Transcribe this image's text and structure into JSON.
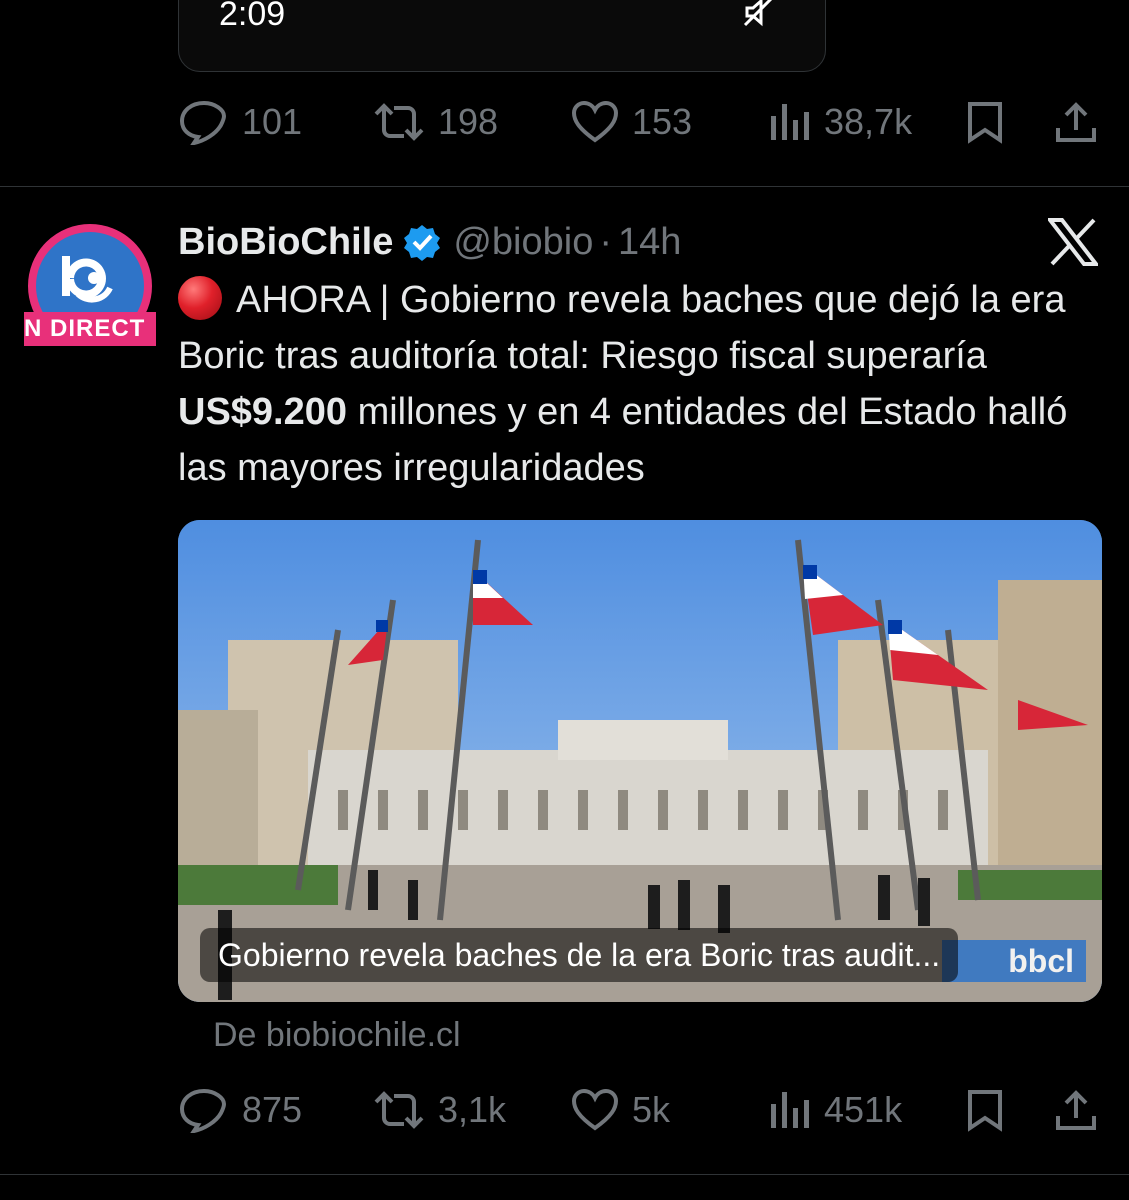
{
  "previous_tweet": {
    "video_time": "2:09",
    "actions": {
      "replies": "101",
      "reposts": "198",
      "likes": "153",
      "views": "38,7k"
    }
  },
  "tweet": {
    "display_name": "BioBioChile",
    "handle": "@biobio",
    "separator": "·",
    "time": "14h",
    "avatar_badge_text": "N DIRECT",
    "text_prefix": "AHORA | Gobierno revela baches que dejó la era Boric tras auditoría total: Riesgo fiscal superaría ",
    "text_bold": "US$9.200",
    "text_suffix": " millones y en 4 entidades del Estado halló las mayores irregularidades",
    "card": {
      "caption": "Gobierno revela baches de la era Boric tras audit...",
      "badge": "bbcl",
      "source": "De biobiochile.cl"
    },
    "actions": {
      "replies": "875",
      "reposts": "3,1k",
      "likes": "5k",
      "views": "451k"
    }
  },
  "colors": {
    "background": "#000000",
    "text": "#e7e9ea",
    "muted": "#71767b",
    "verified": "#1d9bf0",
    "avatar_ring": "#e8307a"
  },
  "icons": [
    "reply-icon",
    "repost-icon",
    "like-icon",
    "views-icon",
    "bookmark-icon",
    "share-icon",
    "verified-icon",
    "x-logo-icon",
    "mute-icon"
  ]
}
